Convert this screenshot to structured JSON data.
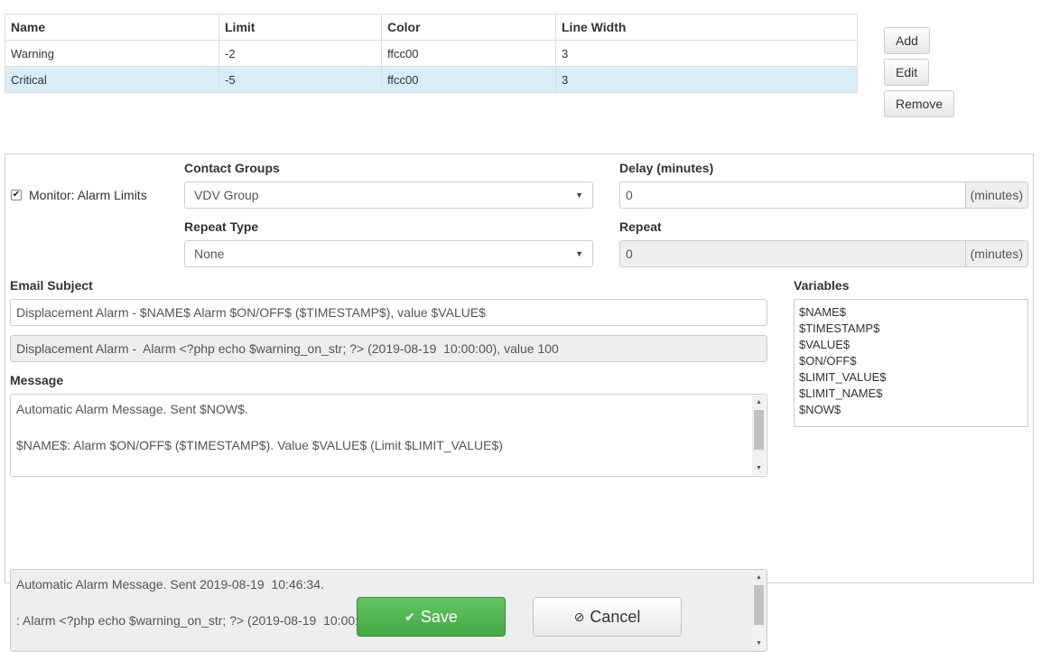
{
  "limits_table": {
    "headers": [
      "Name",
      "Limit",
      "Color",
      "Line Width"
    ],
    "rows": [
      {
        "name": "Warning",
        "limit": "-2",
        "color": "ffcc00",
        "line_width": "3"
      },
      {
        "name": "Critical",
        "limit": "-5",
        "color": "ffcc00",
        "line_width": "3"
      }
    ]
  },
  "table_actions": {
    "add": "Add",
    "edit": "Edit",
    "remove": "Remove"
  },
  "monitor": {
    "checked": true,
    "label": "Monitor: Alarm Limits"
  },
  "contact_groups": {
    "label": "Contact Groups",
    "value": "VDV Group"
  },
  "repeat_type": {
    "label": "Repeat Type",
    "value": "None"
  },
  "delay": {
    "label": "Delay (minutes)",
    "value": "0",
    "unit": "(minutes)"
  },
  "repeat": {
    "label": "Repeat",
    "value": "0",
    "unit": "(minutes)"
  },
  "email_subject": {
    "label": "Email Subject",
    "template": "Displacement Alarm - $NAME$ Alarm $ON/OFF$ ($TIMESTAMP$), value $VALUE$",
    "preview": "Displacement Alarm -  Alarm <?php echo $warning_on_str; ?> (2019-08-19  10:00:00), value 100"
  },
  "message": {
    "label": "Message",
    "template_lines": [
      "Automatic Alarm Message. Sent $NOW$.",
      "",
      "$NAME$: Alarm $ON/OFF$ ($TIMESTAMP$). Value $VALUE$ (Limit $LIMIT_VALUE$)"
    ],
    "preview_lines": [
      "Automatic Alarm Message. Sent 2019-08-19  10:46:34.",
      "",
      ": Alarm <?php echo $warning_on_str; ?> (2019-08-19  10:00:00). Value 100 (Limit )"
    ]
  },
  "variables": {
    "label": "Variables",
    "items": [
      "$NAME$",
      "$TIMESTAMP$",
      "$VALUE$",
      "$ON/OFF$",
      "$LIMIT_VALUE$",
      "$LIMIT_NAME$",
      "$NOW$"
    ]
  },
  "footer": {
    "save_label": "Save",
    "cancel_label": "Cancel"
  },
  "colors": {
    "selected_row": "#d9edf7",
    "save_button": "#4cae4c",
    "readonly_bg": "#eeeeee"
  }
}
